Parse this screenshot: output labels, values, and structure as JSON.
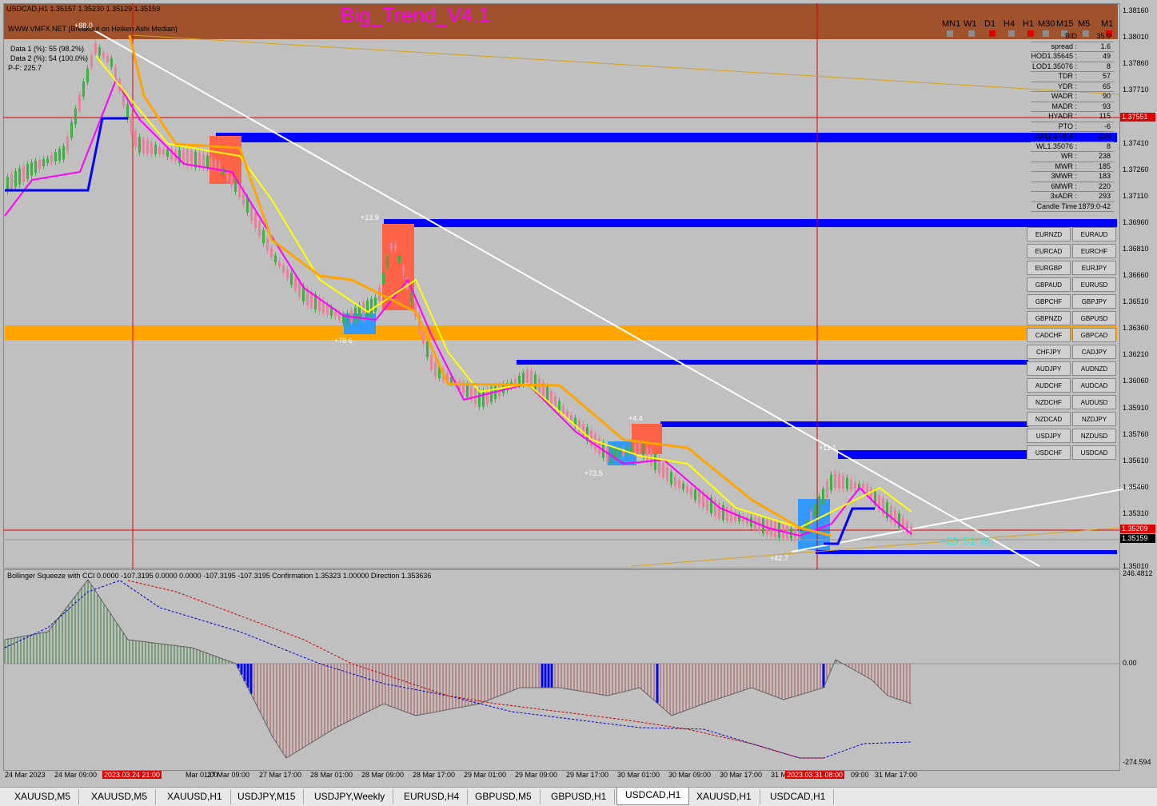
{
  "chart": {
    "symbol_line": "USDCAD,H1  1.35157 1.35230 1.35129 1.35159",
    "indicator_title": "Big_Trend_V4.1",
    "source_line": "WWW.VMFX.NET (Breakout on Heiken Ashi Median)",
    "data1": "Data 1 (%): 55 (98.2%)",
    "data2": "Data 2 (%): 54 (100.0%)",
    "pf": "P-F: 225.7",
    "top_label": "+88.0"
  },
  "timeframes": [
    "MN1",
    "W1",
    "D1",
    "H4",
    "H1",
    "M30",
    "M15",
    "M5",
    "M1"
  ],
  "timeframe_colors": [
    "#8c8c8c",
    "#8c8c8c",
    "#e00000",
    "#8c8c8c",
    "#e00000",
    "#8c8c8c",
    "#8c8c8c",
    "#8c8c8c",
    "#e00000"
  ],
  "stats": [
    {
      "k": "BID",
      "v": "35.9"
    },
    {
      "k": "spread :",
      "v": "1.6"
    },
    {
      "k": "HOD1.35645 :",
      "v": "49"
    },
    {
      "k": "LOD1.35076 :",
      "v": "8"
    },
    {
      "k": "TDR :",
      "v": "57"
    },
    {
      "k": "YDR :",
      "v": "65"
    },
    {
      "k": "WADR :",
      "v": "90"
    },
    {
      "k": "MADR :",
      "v": "93"
    },
    {
      "k": "HYADR :",
      "v": "115"
    },
    {
      "k": "PTO :",
      "v": "-6"
    },
    {
      "k": "WH1.37454 :",
      "v": "229"
    },
    {
      "k": "WL1.35076 :",
      "v": "8"
    },
    {
      "k": "WR :",
      "v": "238"
    },
    {
      "k": "MWR :",
      "v": "185"
    },
    {
      "k": "3MWR :",
      "v": "183"
    },
    {
      "k": "6MWR :",
      "v": "220"
    },
    {
      "k": "3xADR :",
      "v": "293"
    },
    {
      "k": "Candle Time",
      "v": "1879:0-42"
    }
  ],
  "pairs": [
    [
      "EURNZD",
      "EURAUD"
    ],
    [
      "EURCAD",
      "EURCHF"
    ],
    [
      "EURGBP",
      "EURJPY"
    ],
    [
      "GBPAUD",
      "EURUSD"
    ],
    [
      "GBPCHF",
      "GBPJPY"
    ],
    [
      "GBPNZD",
      "GBPUSD"
    ],
    [
      "CADCHF",
      "GBPCAD"
    ],
    [
      "CHFJPY",
      "CADJPY"
    ],
    [
      "AUDJPY",
      "AUDNZD"
    ],
    [
      "AUDCHF",
      "AUDCAD"
    ],
    [
      "NZDCHF",
      "AUDUSD"
    ],
    [
      "NZDCAD",
      "NZDJPY"
    ],
    [
      "USDJPY",
      "NZDUSD"
    ],
    [
      "USDCHF",
      "USDCAD"
    ]
  ],
  "price_ticks": [
    "1.38160",
    "1.38010",
    "1.37860",
    "1.37710",
    "1.37560",
    "1.37410",
    "1.37260",
    "1.37110",
    "1.36960",
    "1.36810",
    "1.36660",
    "1.36510",
    "1.36360",
    "1.36210",
    "1.36060",
    "1.35910",
    "1.35760",
    "1.35610",
    "1.35460",
    "1.35310",
    "1.35160",
    "1.35010"
  ],
  "price_tags": [
    {
      "text": "1.37551",
      "color": "#e00000"
    },
    {
      "text": "1.35209",
      "color": "#e00000"
    },
    {
      "text": "1.35159",
      "color": "#000000"
    }
  ],
  "annotations": [
    "+13.9",
    "+78.6",
    "+4.4",
    "+73.5",
    "+11.1",
    "+42.7",
    "+23 :51 :(6)"
  ],
  "subchart": {
    "title": "Bollinger Squeeze with CCI 0.0000 -107.3195 0.0000 0.0000 -107.3195 -107.3195  Confirmation 1.35323 1.00000  Direction 1.353636",
    "ticks": [
      "246.4812",
      "0.00",
      "-274.594"
    ]
  },
  "time_labels": [
    {
      "text": "24 Mar 2023",
      "hl": false
    },
    {
      "text": "24 Mar 09:00",
      "hl": false
    },
    {
      "text": "2023.03.24 21:00",
      "hl": true
    },
    {
      "text": "Mar 01:00",
      "hl": false
    },
    {
      "text": "27 Mar 09:00",
      "hl": false
    },
    {
      "text": "27 Mar 17:00",
      "hl": false
    },
    {
      "text": "28 Mar 01:00",
      "hl": false
    },
    {
      "text": "28 Mar 09:00",
      "hl": false
    },
    {
      "text": "28 Mar 17:00",
      "hl": false
    },
    {
      "text": "29 Mar 01:00",
      "hl": false
    },
    {
      "text": "29 Mar 09:00",
      "hl": false
    },
    {
      "text": "29 Mar 17:00",
      "hl": false
    },
    {
      "text": "30 Mar 01:00",
      "hl": false
    },
    {
      "text": "30 Mar 09:00",
      "hl": false
    },
    {
      "text": "30 Mar 17:00",
      "hl": false
    },
    {
      "text": "31 M",
      "hl": false
    },
    {
      "text": "2023.03.31 08:00",
      "hl": true
    },
    {
      "text": "09:00",
      "hl": false
    },
    {
      "text": "31 Mar 17:00",
      "hl": false
    }
  ],
  "tabs": [
    "XAUUSD,M5",
    "XAUUSD,M5",
    "XAUUSD,H1",
    "USDJPY,M15",
    "USDJPY,Weekly",
    "EURUSD,H4",
    "GBPUSD,M5",
    "GBPUSD,H1",
    "USDCAD,H1",
    "XAUUSD,H1",
    "USDCAD,H1"
  ],
  "active_tab": 8,
  "colors": {
    "bull": "#3cb043",
    "bear": "#e8829a",
    "magenta": "#ff00ff",
    "yellow": "#ffff00",
    "orange": "#ffa500",
    "blue": "#0000ff",
    "white": "#ffffff",
    "band": "#a0522d"
  }
}
